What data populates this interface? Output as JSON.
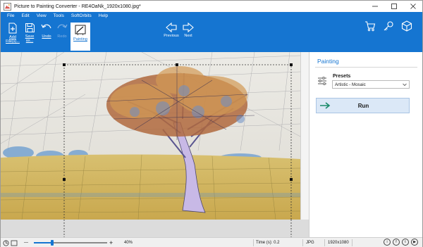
{
  "window": {
    "title": "Picture to Painting Converter - RE4OaNk_1920x1080.jpg*"
  },
  "menu": [
    "File",
    "Edit",
    "View",
    "Tools",
    "SoftOrbits",
    "Help"
  ],
  "toolbar": {
    "add_files": "Add File(s)...",
    "save_as": "Save as...",
    "undo": "Undo",
    "redo": "Redo",
    "painting": "Painting",
    "previous": "Previous",
    "next": "Next"
  },
  "panel": {
    "title": "Painting",
    "presets_label": "Presets",
    "preset_selected": "Artistic - Mosaic",
    "run_label": "Run"
  },
  "status": {
    "zoom_minus": "—",
    "zoom_plus": "+",
    "zoom_level": "40%",
    "zoom_fraction": 0.25,
    "time": "Time (s): 0.2",
    "format": "JPG",
    "dimensions": "1920x1080",
    "social": [
      "i",
      "f",
      "t",
      "▶"
    ]
  },
  "colors": {
    "accent": "#1575d1",
    "panel_title": "#1575d1",
    "run_bg": "#dbe8f7"
  }
}
